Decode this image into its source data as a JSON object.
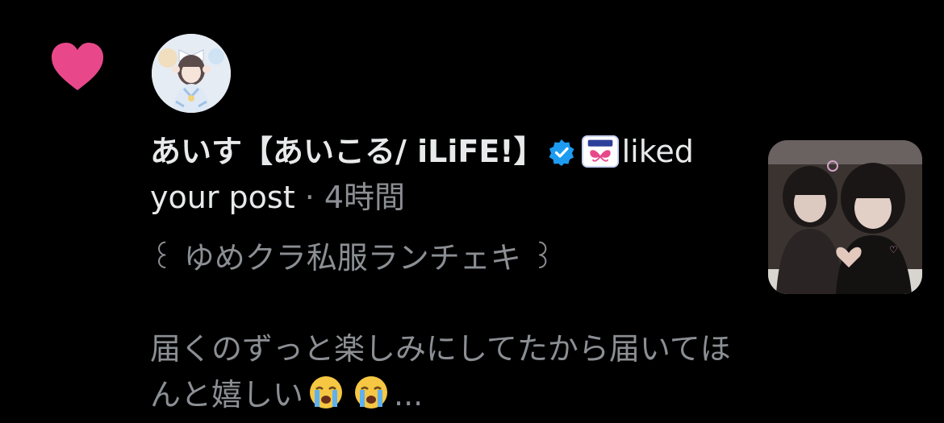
{
  "notification": {
    "type_icon": "heart-icon",
    "accent_color": "#e8488a",
    "user": {
      "display_name": "あいす【あいこる/ iLiFE!】",
      "verified": true,
      "verified_color": "#1d9bf0",
      "affiliate_badge": "iLiFE!"
    },
    "action_text": "liked your post",
    "separator": "·",
    "time": "4時間",
    "post": {
      "title": "꒰ ゆめクラ私服ランチェキ ꒱",
      "body_text": "届くのずっと楽しみにしてたから届いてほんと嬉しい",
      "emojis": [
        "crying-face-emoji",
        "crying-face-emoji"
      ],
      "ellipsis": "..."
    }
  }
}
